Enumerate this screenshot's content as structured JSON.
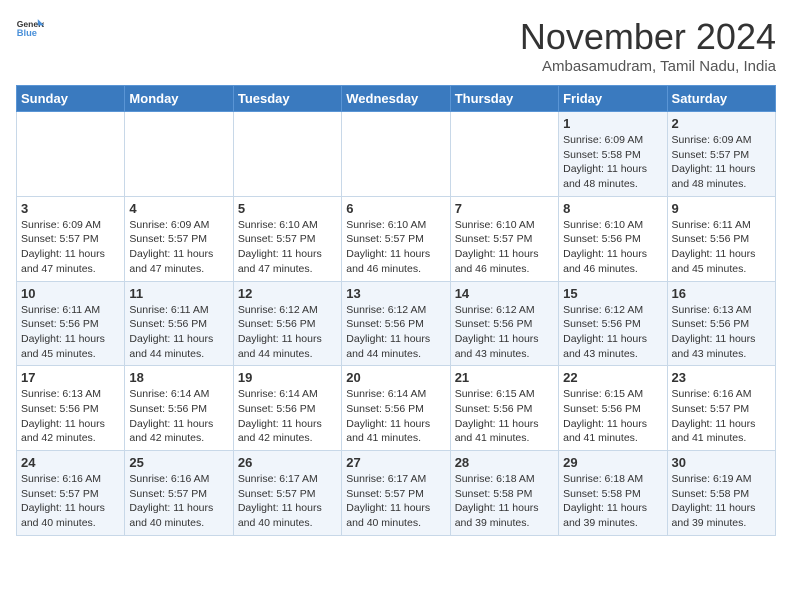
{
  "header": {
    "logo_line1": "General",
    "logo_line2": "Blue",
    "month_title": "November 2024",
    "location": "Ambasamudram, Tamil Nadu, India"
  },
  "weekdays": [
    "Sunday",
    "Monday",
    "Tuesday",
    "Wednesday",
    "Thursday",
    "Friday",
    "Saturday"
  ],
  "weeks": [
    [
      {
        "day": "",
        "info": ""
      },
      {
        "day": "",
        "info": ""
      },
      {
        "day": "",
        "info": ""
      },
      {
        "day": "",
        "info": ""
      },
      {
        "day": "",
        "info": ""
      },
      {
        "day": "1",
        "info": "Sunrise: 6:09 AM\nSunset: 5:58 PM\nDaylight: 11 hours\nand 48 minutes."
      },
      {
        "day": "2",
        "info": "Sunrise: 6:09 AM\nSunset: 5:57 PM\nDaylight: 11 hours\nand 48 minutes."
      }
    ],
    [
      {
        "day": "3",
        "info": "Sunrise: 6:09 AM\nSunset: 5:57 PM\nDaylight: 11 hours\nand 47 minutes."
      },
      {
        "day": "4",
        "info": "Sunrise: 6:09 AM\nSunset: 5:57 PM\nDaylight: 11 hours\nand 47 minutes."
      },
      {
        "day": "5",
        "info": "Sunrise: 6:10 AM\nSunset: 5:57 PM\nDaylight: 11 hours\nand 47 minutes."
      },
      {
        "day": "6",
        "info": "Sunrise: 6:10 AM\nSunset: 5:57 PM\nDaylight: 11 hours\nand 46 minutes."
      },
      {
        "day": "7",
        "info": "Sunrise: 6:10 AM\nSunset: 5:57 PM\nDaylight: 11 hours\nand 46 minutes."
      },
      {
        "day": "8",
        "info": "Sunrise: 6:10 AM\nSunset: 5:56 PM\nDaylight: 11 hours\nand 46 minutes."
      },
      {
        "day": "9",
        "info": "Sunrise: 6:11 AM\nSunset: 5:56 PM\nDaylight: 11 hours\nand 45 minutes."
      }
    ],
    [
      {
        "day": "10",
        "info": "Sunrise: 6:11 AM\nSunset: 5:56 PM\nDaylight: 11 hours\nand 45 minutes."
      },
      {
        "day": "11",
        "info": "Sunrise: 6:11 AM\nSunset: 5:56 PM\nDaylight: 11 hours\nand 44 minutes."
      },
      {
        "day": "12",
        "info": "Sunrise: 6:12 AM\nSunset: 5:56 PM\nDaylight: 11 hours\nand 44 minutes."
      },
      {
        "day": "13",
        "info": "Sunrise: 6:12 AM\nSunset: 5:56 PM\nDaylight: 11 hours\nand 44 minutes."
      },
      {
        "day": "14",
        "info": "Sunrise: 6:12 AM\nSunset: 5:56 PM\nDaylight: 11 hours\nand 43 minutes."
      },
      {
        "day": "15",
        "info": "Sunrise: 6:12 AM\nSunset: 5:56 PM\nDaylight: 11 hours\nand 43 minutes."
      },
      {
        "day": "16",
        "info": "Sunrise: 6:13 AM\nSunset: 5:56 PM\nDaylight: 11 hours\nand 43 minutes."
      }
    ],
    [
      {
        "day": "17",
        "info": "Sunrise: 6:13 AM\nSunset: 5:56 PM\nDaylight: 11 hours\nand 42 minutes."
      },
      {
        "day": "18",
        "info": "Sunrise: 6:14 AM\nSunset: 5:56 PM\nDaylight: 11 hours\nand 42 minutes."
      },
      {
        "day": "19",
        "info": "Sunrise: 6:14 AM\nSunset: 5:56 PM\nDaylight: 11 hours\nand 42 minutes."
      },
      {
        "day": "20",
        "info": "Sunrise: 6:14 AM\nSunset: 5:56 PM\nDaylight: 11 hours\nand 41 minutes."
      },
      {
        "day": "21",
        "info": "Sunrise: 6:15 AM\nSunset: 5:56 PM\nDaylight: 11 hours\nand 41 minutes."
      },
      {
        "day": "22",
        "info": "Sunrise: 6:15 AM\nSunset: 5:56 PM\nDaylight: 11 hours\nand 41 minutes."
      },
      {
        "day": "23",
        "info": "Sunrise: 6:16 AM\nSunset: 5:57 PM\nDaylight: 11 hours\nand 41 minutes."
      }
    ],
    [
      {
        "day": "24",
        "info": "Sunrise: 6:16 AM\nSunset: 5:57 PM\nDaylight: 11 hours\nand 40 minutes."
      },
      {
        "day": "25",
        "info": "Sunrise: 6:16 AM\nSunset: 5:57 PM\nDaylight: 11 hours\nand 40 minutes."
      },
      {
        "day": "26",
        "info": "Sunrise: 6:17 AM\nSunset: 5:57 PM\nDaylight: 11 hours\nand 40 minutes."
      },
      {
        "day": "27",
        "info": "Sunrise: 6:17 AM\nSunset: 5:57 PM\nDaylight: 11 hours\nand 40 minutes."
      },
      {
        "day": "28",
        "info": "Sunrise: 6:18 AM\nSunset: 5:58 PM\nDaylight: 11 hours\nand 39 minutes."
      },
      {
        "day": "29",
        "info": "Sunrise: 6:18 AM\nSunset: 5:58 PM\nDaylight: 11 hours\nand 39 minutes."
      },
      {
        "day": "30",
        "info": "Sunrise: 6:19 AM\nSunset: 5:58 PM\nDaylight: 11 hours\nand 39 minutes."
      }
    ]
  ]
}
